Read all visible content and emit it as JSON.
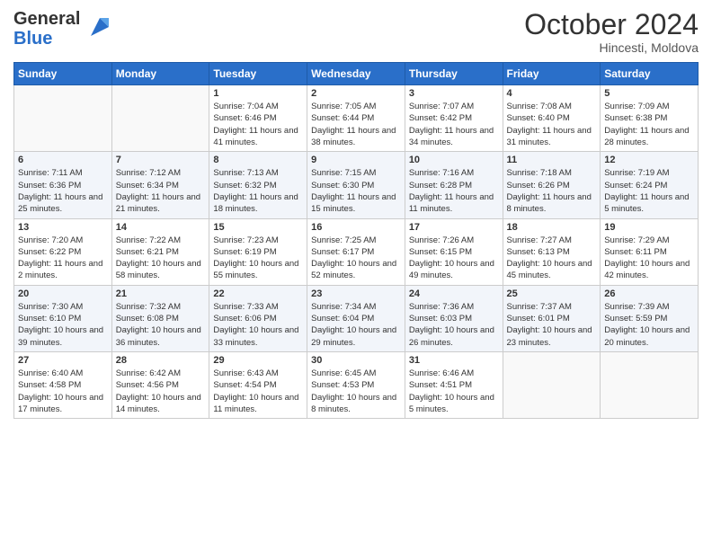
{
  "header": {
    "logo_general": "General",
    "logo_blue": "Blue",
    "month_title": "October 2024",
    "subtitle": "Hincesti, Moldova"
  },
  "weekdays": [
    "Sunday",
    "Monday",
    "Tuesday",
    "Wednesday",
    "Thursday",
    "Friday",
    "Saturday"
  ],
  "weeks": [
    [
      {
        "day": "",
        "info": ""
      },
      {
        "day": "",
        "info": ""
      },
      {
        "day": "1",
        "info": "Sunrise: 7:04 AM\nSunset: 6:46 PM\nDaylight: 11 hours and 41 minutes."
      },
      {
        "day": "2",
        "info": "Sunrise: 7:05 AM\nSunset: 6:44 PM\nDaylight: 11 hours and 38 minutes."
      },
      {
        "day": "3",
        "info": "Sunrise: 7:07 AM\nSunset: 6:42 PM\nDaylight: 11 hours and 34 minutes."
      },
      {
        "day": "4",
        "info": "Sunrise: 7:08 AM\nSunset: 6:40 PM\nDaylight: 11 hours and 31 minutes."
      },
      {
        "day": "5",
        "info": "Sunrise: 7:09 AM\nSunset: 6:38 PM\nDaylight: 11 hours and 28 minutes."
      }
    ],
    [
      {
        "day": "6",
        "info": "Sunrise: 7:11 AM\nSunset: 6:36 PM\nDaylight: 11 hours and 25 minutes."
      },
      {
        "day": "7",
        "info": "Sunrise: 7:12 AM\nSunset: 6:34 PM\nDaylight: 11 hours and 21 minutes."
      },
      {
        "day": "8",
        "info": "Sunrise: 7:13 AM\nSunset: 6:32 PM\nDaylight: 11 hours and 18 minutes."
      },
      {
        "day": "9",
        "info": "Sunrise: 7:15 AM\nSunset: 6:30 PM\nDaylight: 11 hours and 15 minutes."
      },
      {
        "day": "10",
        "info": "Sunrise: 7:16 AM\nSunset: 6:28 PM\nDaylight: 11 hours and 11 minutes."
      },
      {
        "day": "11",
        "info": "Sunrise: 7:18 AM\nSunset: 6:26 PM\nDaylight: 11 hours and 8 minutes."
      },
      {
        "day": "12",
        "info": "Sunrise: 7:19 AM\nSunset: 6:24 PM\nDaylight: 11 hours and 5 minutes."
      }
    ],
    [
      {
        "day": "13",
        "info": "Sunrise: 7:20 AM\nSunset: 6:22 PM\nDaylight: 11 hours and 2 minutes."
      },
      {
        "day": "14",
        "info": "Sunrise: 7:22 AM\nSunset: 6:21 PM\nDaylight: 10 hours and 58 minutes."
      },
      {
        "day": "15",
        "info": "Sunrise: 7:23 AM\nSunset: 6:19 PM\nDaylight: 10 hours and 55 minutes."
      },
      {
        "day": "16",
        "info": "Sunrise: 7:25 AM\nSunset: 6:17 PM\nDaylight: 10 hours and 52 minutes."
      },
      {
        "day": "17",
        "info": "Sunrise: 7:26 AM\nSunset: 6:15 PM\nDaylight: 10 hours and 49 minutes."
      },
      {
        "day": "18",
        "info": "Sunrise: 7:27 AM\nSunset: 6:13 PM\nDaylight: 10 hours and 45 minutes."
      },
      {
        "day": "19",
        "info": "Sunrise: 7:29 AM\nSunset: 6:11 PM\nDaylight: 10 hours and 42 minutes."
      }
    ],
    [
      {
        "day": "20",
        "info": "Sunrise: 7:30 AM\nSunset: 6:10 PM\nDaylight: 10 hours and 39 minutes."
      },
      {
        "day": "21",
        "info": "Sunrise: 7:32 AM\nSunset: 6:08 PM\nDaylight: 10 hours and 36 minutes."
      },
      {
        "day": "22",
        "info": "Sunrise: 7:33 AM\nSunset: 6:06 PM\nDaylight: 10 hours and 33 minutes."
      },
      {
        "day": "23",
        "info": "Sunrise: 7:34 AM\nSunset: 6:04 PM\nDaylight: 10 hours and 29 minutes."
      },
      {
        "day": "24",
        "info": "Sunrise: 7:36 AM\nSunset: 6:03 PM\nDaylight: 10 hours and 26 minutes."
      },
      {
        "day": "25",
        "info": "Sunrise: 7:37 AM\nSunset: 6:01 PM\nDaylight: 10 hours and 23 minutes."
      },
      {
        "day": "26",
        "info": "Sunrise: 7:39 AM\nSunset: 5:59 PM\nDaylight: 10 hours and 20 minutes."
      }
    ],
    [
      {
        "day": "27",
        "info": "Sunrise: 6:40 AM\nSunset: 4:58 PM\nDaylight: 10 hours and 17 minutes."
      },
      {
        "day": "28",
        "info": "Sunrise: 6:42 AM\nSunset: 4:56 PM\nDaylight: 10 hours and 14 minutes."
      },
      {
        "day": "29",
        "info": "Sunrise: 6:43 AM\nSunset: 4:54 PM\nDaylight: 10 hours and 11 minutes."
      },
      {
        "day": "30",
        "info": "Sunrise: 6:45 AM\nSunset: 4:53 PM\nDaylight: 10 hours and 8 minutes."
      },
      {
        "day": "31",
        "info": "Sunrise: 6:46 AM\nSunset: 4:51 PM\nDaylight: 10 hours and 5 minutes."
      },
      {
        "day": "",
        "info": ""
      },
      {
        "day": "",
        "info": ""
      }
    ]
  ]
}
